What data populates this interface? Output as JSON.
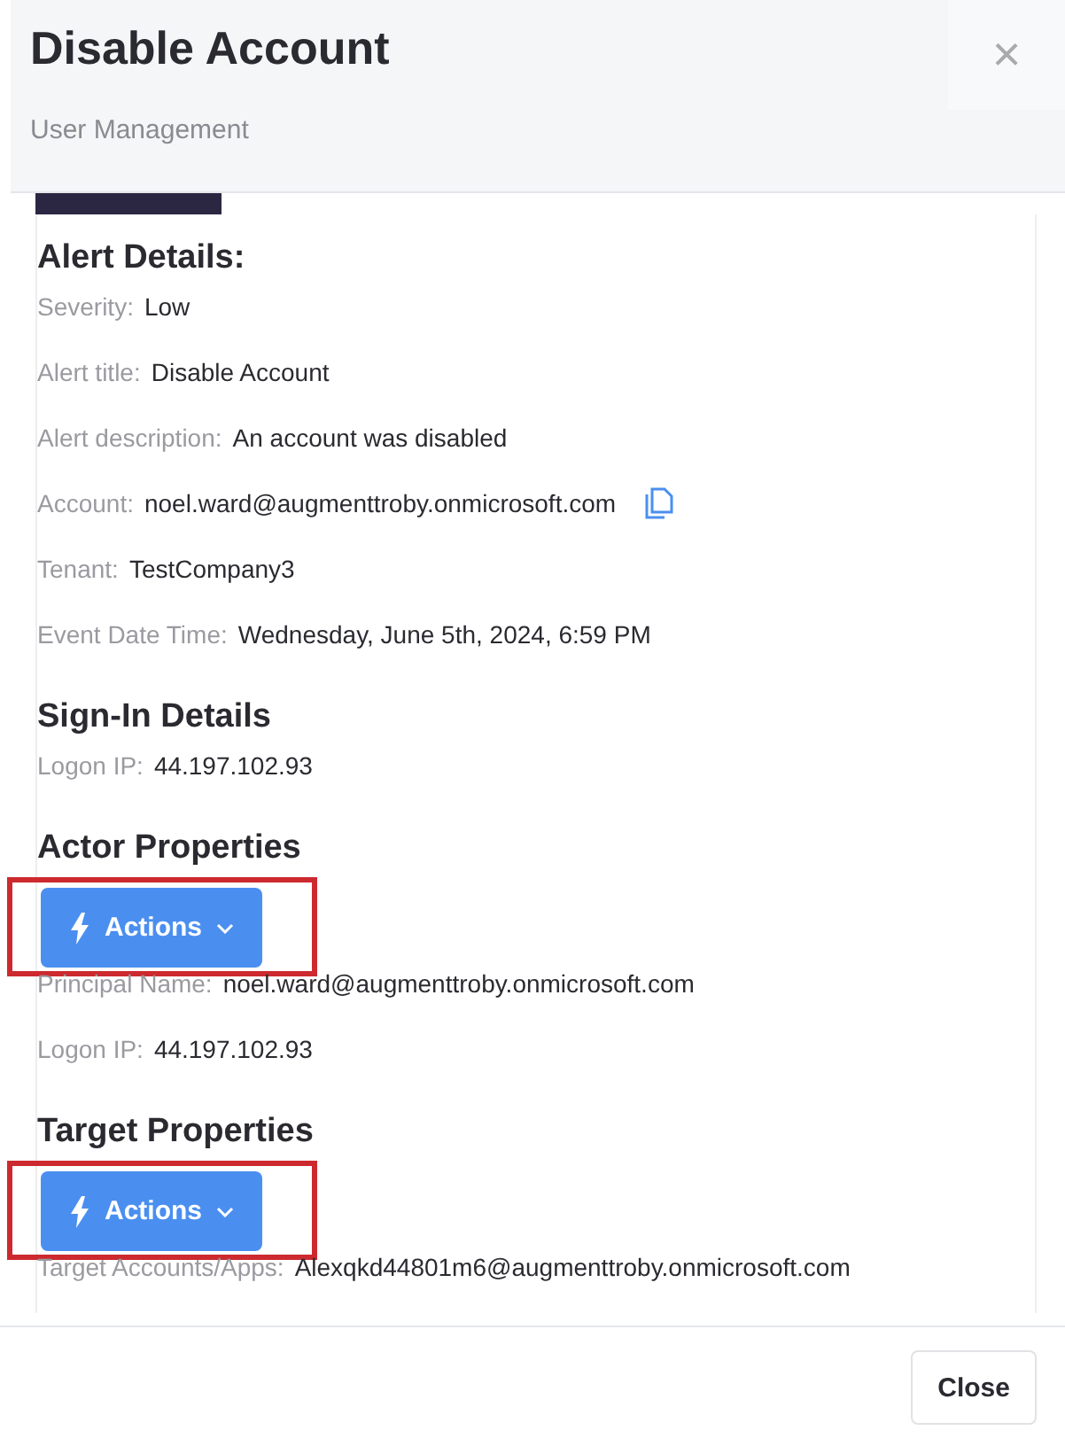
{
  "header": {
    "title": "Disable Account",
    "subtitle": "User Management",
    "close_icon": "×"
  },
  "tabs": [
    {
      "selected": true
    }
  ],
  "sections": [
    {
      "title": "Alert Details:",
      "fields": [
        {
          "label": "Severity:",
          "value": "Low"
        },
        {
          "label": "Alert title:",
          "value": "Disable Account"
        },
        {
          "label": "Alert description:",
          "value": "An account was disabled"
        },
        {
          "label": "Account:",
          "value": "noel.ward@augmenttroby.onmicrosoft.com",
          "copy": true
        },
        {
          "label": "Tenant:",
          "value": "TestCompany3"
        },
        {
          "label": "Event Date Time:",
          "value": "Wednesday, June 5th, 2024, 6:59 PM"
        }
      ]
    },
    {
      "title": "Sign-In Details",
      "fields": [
        {
          "label": "Logon IP:",
          "value": "44.197.102.93"
        }
      ]
    },
    {
      "title": "Actor Properties",
      "actions": "Actions",
      "highlighted": true,
      "fields": [
        {
          "label": "Principal Name:",
          "value": "noel.ward@augmenttroby.onmicrosoft.com"
        },
        {
          "label": "Logon IP:",
          "value": "44.197.102.93"
        }
      ]
    },
    {
      "title": "Target Properties",
      "actions": "Actions",
      "highlighted": true,
      "fields": [
        {
          "label": "Target Accounts/Apps:",
          "value": "Alexqkd44801m6@augmenttroby.onmicrosoft.com"
        }
      ]
    }
  ],
  "footer": {
    "close_button": "Close"
  }
}
